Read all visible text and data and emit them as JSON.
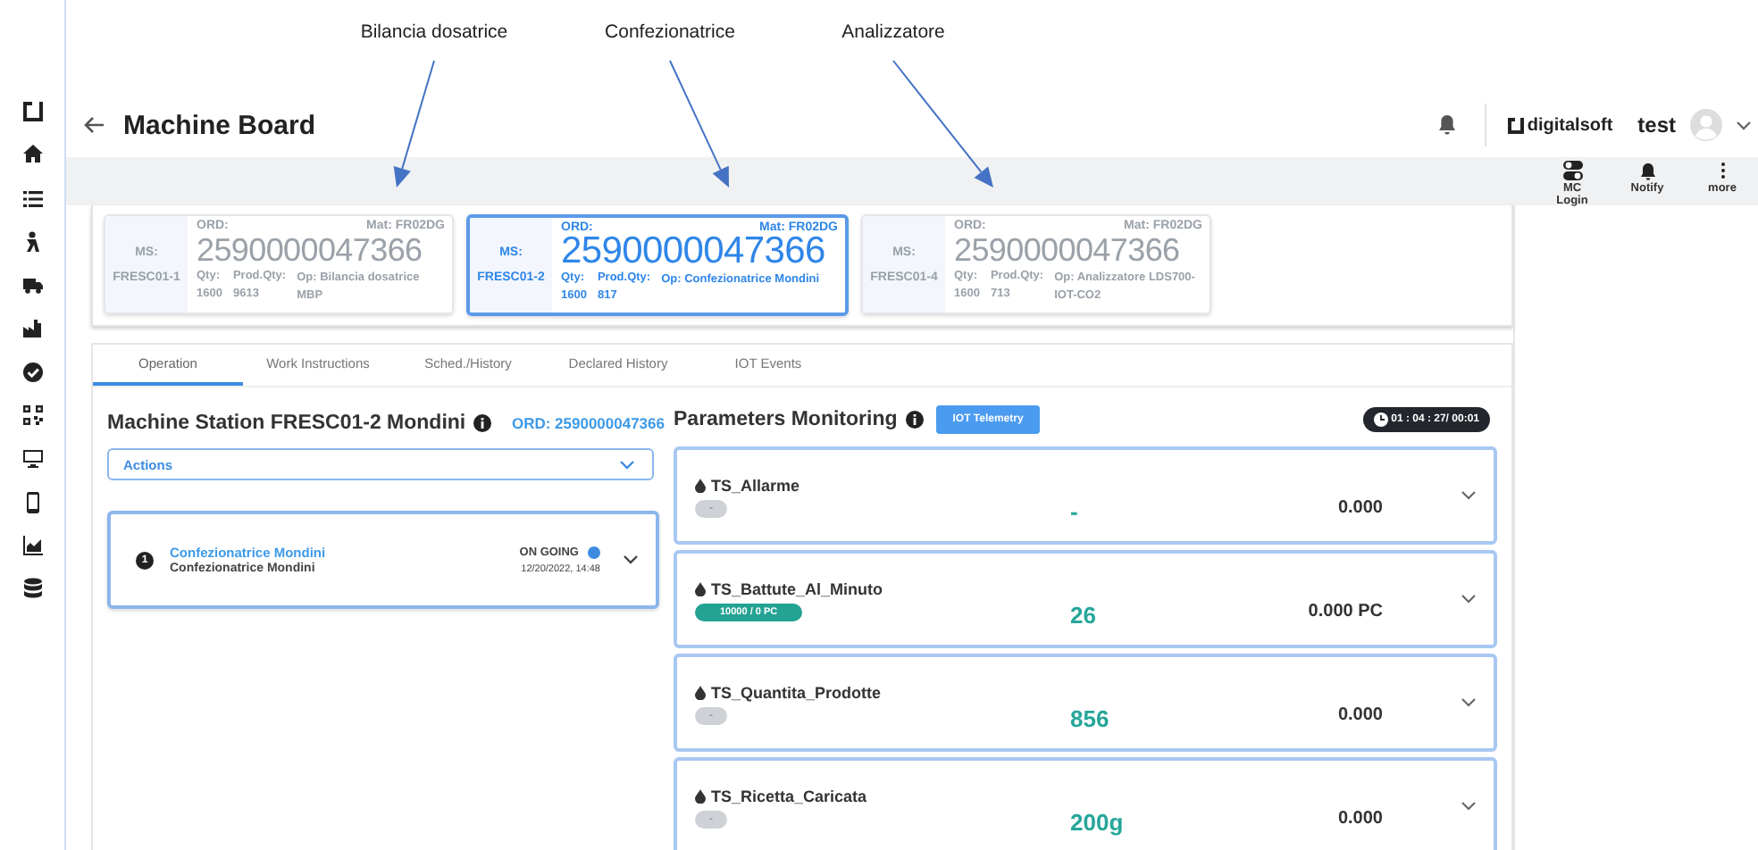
{
  "annotations": [
    {
      "label": "Bilancia dosatrice"
    },
    {
      "label": "Confezionatrice"
    },
    {
      "label": "Analizzatore"
    }
  ],
  "header": {
    "title": "Machine Board",
    "brand": "digitalsoft",
    "user": "test"
  },
  "toolbar": [
    {
      "label": "MC Login",
      "kind": "toggle"
    },
    {
      "label": "Notify",
      "kind": "bell"
    },
    {
      "label": "more",
      "kind": "dots"
    }
  ],
  "machines": [
    {
      "ms_label": "MS:",
      "station": "FRESC01-1",
      "ord_label": "ORD:",
      "material": "Mat: FR02DG",
      "order": "2590000047366",
      "qty_label": "Qty:",
      "qty": "1600",
      "prod_label": "Prod.Qty:",
      "prod_qty": "9613",
      "operation": "Op: Bilancia dosatrice MBP",
      "selected": false
    },
    {
      "ms_label": "MS:",
      "station": "FRESC01-2",
      "ord_label": "ORD:",
      "material": "Mat: FR02DG",
      "order": "2590000047366",
      "qty_label": "Qty:",
      "qty": "1600",
      "prod_label": "Prod.Qty:",
      "prod_qty": "817",
      "operation": "Op: Confezionatrice Mondini",
      "selected": true
    },
    {
      "ms_label": "MS:",
      "station": "FRESC01-4",
      "ord_label": "ORD:",
      "material": "Mat: FR02DG",
      "order": "2590000047366",
      "qty_label": "Qty:",
      "qty": "1600",
      "prod_label": "Prod.Qty:",
      "prod_qty": "713",
      "operation": "Op: Analizzatore LDS700-IOT-CO2",
      "selected": false
    }
  ],
  "tabs": [
    {
      "label": "Operation",
      "selected": true
    },
    {
      "label": "Work Instructions",
      "selected": false
    },
    {
      "label": "Sched./History",
      "selected": false
    },
    {
      "label": "Declared History",
      "selected": false
    },
    {
      "label": "IOT Events",
      "selected": false
    }
  ],
  "station": {
    "title": "Machine Station FRESC01-2 Mondini",
    "order": "ORD: 2590000047366",
    "actions": "Actions"
  },
  "operations": [
    {
      "number": "1",
      "title": "Confezionatrice Mondini",
      "subtitle": "Confezionatrice Mondini",
      "status": "ON GOING",
      "timestamp": "12/20/2022, 14:48"
    }
  ],
  "monitoring": {
    "title": "Parameters Monitoring",
    "button": "IOT Telemetry",
    "timer": "01 : 04 : 27/ 00:01"
  },
  "parameters": [
    {
      "name": "TS_Allarme",
      "badge": {
        "text": "-",
        "kind": "neutral"
      },
      "value": "-",
      "reading": "0.000"
    },
    {
      "name": "TS_Battute_Al_Minuto",
      "badge": {
        "text": "10000 / 0 PC",
        "kind": "target"
      },
      "value": "26",
      "reading": "0.000 PC"
    },
    {
      "name": "TS_Quantita_Prodotte",
      "badge": {
        "text": "-",
        "kind": "neutral"
      },
      "value": "856",
      "reading": "0.000"
    },
    {
      "name": "TS_Ricetta_Caricata",
      "badge": {
        "text": "-",
        "kind": "neutral"
      },
      "value": "200g",
      "reading": "0.000"
    }
  ]
}
